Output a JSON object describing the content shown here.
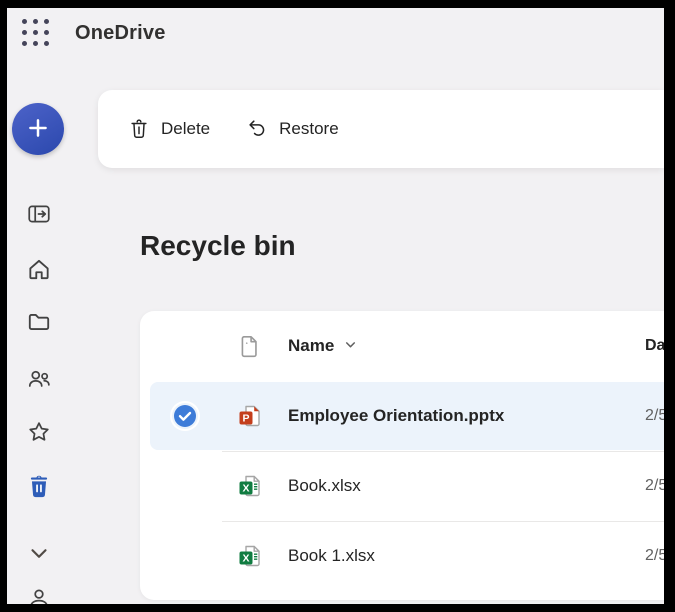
{
  "header": {
    "app_title": "OneDrive"
  },
  "sidebar": {
    "new_button": {
      "icon": "plus-icon"
    },
    "items": [
      {
        "name": "expand-navigation",
        "icon": "panel-arrow"
      },
      {
        "name": "home",
        "icon": "home"
      },
      {
        "name": "my-files",
        "icon": "folder"
      },
      {
        "name": "people",
        "icon": "people"
      },
      {
        "name": "favorites",
        "icon": "star"
      },
      {
        "name": "recycle-bin",
        "icon": "trash-filled",
        "active": true
      },
      {
        "name": "more",
        "icon": "chevron-down"
      },
      {
        "name": "account",
        "icon": "person"
      }
    ]
  },
  "toolbar": {
    "delete_label": "Delete",
    "restore_label": "Restore"
  },
  "page": {
    "title": "Recycle bin"
  },
  "table": {
    "columns": {
      "name": "Name",
      "date_partial": "Da"
    },
    "rows": [
      {
        "name": "Employee Orientation.pptx",
        "type": "pptx",
        "icon": "powerpoint-file-icon",
        "date_partial": "2/5",
        "selected": true
      },
      {
        "name": "Book.xlsx",
        "type": "xlsx",
        "icon": "excel-file-icon",
        "date_partial": "2/5",
        "selected": false
      },
      {
        "name": "Book 1.xlsx",
        "type": "xlsx",
        "icon": "excel-file-icon",
        "date_partial": "2/5",
        "selected": false
      }
    ]
  },
  "colors": {
    "app_background": "#f2f1f3",
    "accent_blue": "#2e5db8",
    "selected_row_bg": "#ecf3fb",
    "check_circle_blue": "#3e7cd8",
    "fab_gradient_start": "#4d63c9",
    "fab_gradient_end": "#2b48ad",
    "powerpoint_red": "#c43e1c",
    "excel_green": "#107c41",
    "text_primary": "#242424",
    "text_secondary": "#616161"
  }
}
